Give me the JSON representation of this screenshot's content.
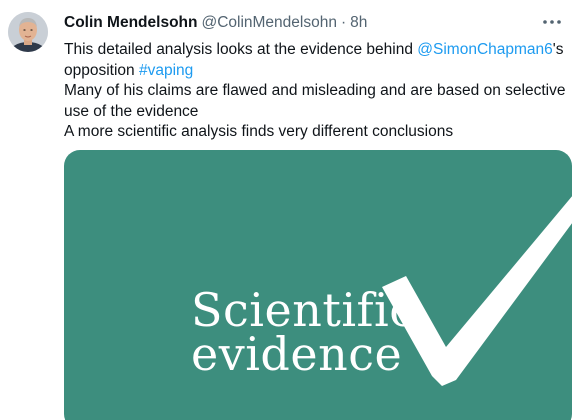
{
  "tweet": {
    "author": {
      "display_name": "Colin Mendelsohn",
      "handle": "@ColinMendelsohn",
      "separator": "·",
      "timestamp": "8h"
    },
    "more_icon": "more-horizontal-icon",
    "text": {
      "line1_before": "This detailed analysis looks at the evidence behind ",
      "line1_mention": "@SimonChapman6",
      "line1_after": "'s",
      "line2_before": "opposition ",
      "line2_hashtag": "#vaping",
      "line3": "Many of his claims are flawed and misleading and are based on selective",
      "line4": "use of the evidence",
      "line5": "A more scientific analysis finds very different conclusions"
    },
    "media": {
      "caption_line1": "Scientific",
      "caption_line2": "evidence",
      "background_color": "#3d8e7e",
      "icon": "checkmark-icon"
    },
    "colors": {
      "link": "#1d9bf0",
      "text": "#0f1419",
      "secondary": "#536471"
    }
  }
}
